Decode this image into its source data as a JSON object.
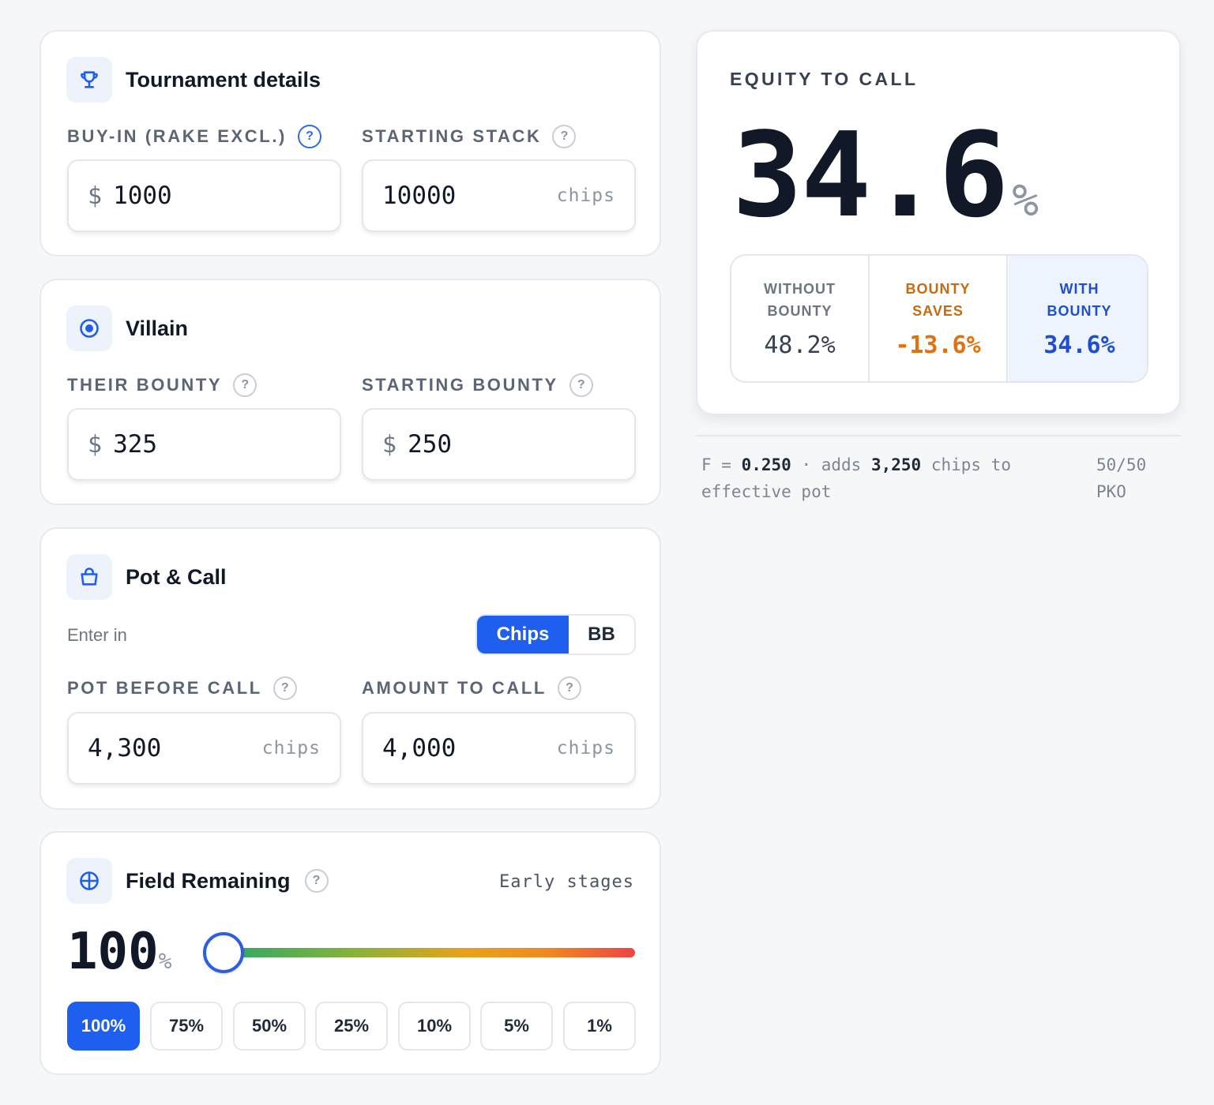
{
  "tournament": {
    "title": "Tournament details",
    "buyin_label": "BUY-IN (RAKE EXCL.)",
    "buyin_prefix": "$",
    "buyin_value": "1000",
    "stack_label": "STARTING STACK",
    "stack_value": "10000",
    "stack_suffix": "chips"
  },
  "villain": {
    "title": "Villain",
    "their_bounty_label": "THEIR BOUNTY",
    "their_bounty_prefix": "$",
    "their_bounty_value": "325",
    "starting_bounty_label": "STARTING BOUNTY",
    "starting_bounty_prefix": "$",
    "starting_bounty_value": "250"
  },
  "pot": {
    "title": "Pot & Call",
    "enter_in_label": "Enter in",
    "unit_options": [
      "Chips",
      "BB"
    ],
    "unit_selected": "Chips",
    "pot_label": "POT BEFORE CALL",
    "pot_value": "4,300",
    "pot_suffix": "chips",
    "call_label": "AMOUNT TO CALL",
    "call_value": "4,000",
    "call_suffix": "chips"
  },
  "field": {
    "title": "Field Remaining",
    "stage": "Early stages",
    "value": "100",
    "unit": "%",
    "slider_fraction": 1.0,
    "presets": [
      "100%",
      "75%",
      "50%",
      "25%",
      "10%",
      "5%",
      "1%"
    ],
    "preset_selected": "100%"
  },
  "equity": {
    "title": "EQUITY TO CALL",
    "value": "34.6",
    "unit": "%",
    "without_label_1": "WITHOUT",
    "without_label_2": "BOUNTY",
    "without_value": "48.2%",
    "saves_label_1": "BOUNTY",
    "saves_label_2": "SAVES",
    "saves_value": "-13.6%",
    "with_label_1": "WITH",
    "with_label_2": "BOUNTY",
    "with_value": "34.6%"
  },
  "footnote": {
    "f_prefix": "F = ",
    "f_value": "0.250",
    "dot": " · adds ",
    "chips_value": "3,250",
    "tail_1": " chips to",
    "tail_2": "effective pot",
    "format_1": "50/50",
    "format_2": "PKO"
  },
  "colors": {
    "accent": "#1f5ff0",
    "saves": "#e07010",
    "with": "#1f4fd0"
  }
}
